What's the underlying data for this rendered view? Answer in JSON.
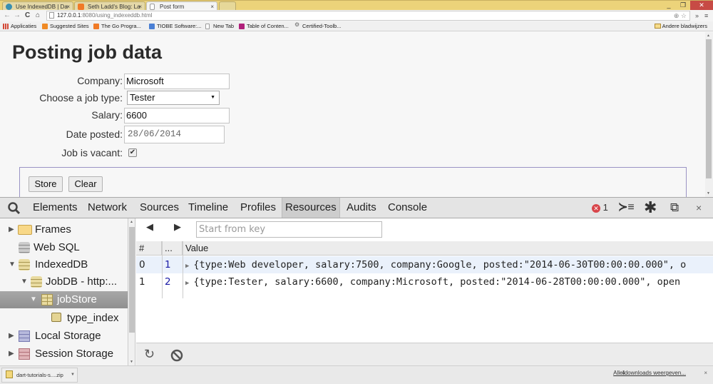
{
  "browser": {
    "tabs": [
      {
        "title": "Use IndexedDB | Da",
        "icon": "dart-icon",
        "icon_color": "#3a8fb0",
        "active": false
      },
      {
        "title": "Seth Ladd's Blog: La",
        "icon": "blogger-icon",
        "icon_color": "#f07a27",
        "active": false
      },
      {
        "title": "Post form",
        "icon": "page-icon",
        "icon_color": "#ffffff",
        "active": true
      }
    ],
    "url_host": "127.0.0.1",
    "url_rest": ":8080/using_indexeddb.html",
    "bookmarks": [
      {
        "label": "Applicaties",
        "icon": "apps-grid-icon",
        "color": "#d34836"
      },
      {
        "label": "Suggested Sites",
        "icon": "suggested-sites-icon",
        "color": "#f08a24"
      },
      {
        "label": "The Go Progra...",
        "icon": "blogger-icon",
        "color": "#f07a27"
      },
      {
        "label": "TIOBE Software:...",
        "icon": "tiobe-icon",
        "color": "#4a7fd4"
      },
      {
        "label": "New Tab",
        "icon": "page-icon",
        "color": "#ffffff"
      },
      {
        "label": "Table of Conten...",
        "icon": "toc-icon",
        "color": "#b0207a"
      },
      {
        "label": "Certified-Toolb...",
        "icon": "toolbox-icon",
        "color": "#666666"
      }
    ],
    "other_bookmarks": "Andere bladwijzers"
  },
  "page": {
    "title": "Posting job data",
    "form": {
      "company_label": "Company:",
      "company_value": "Microsoft",
      "job_type_label": "Choose a job type:",
      "job_type_value": "Tester",
      "salary_label": "Salary:",
      "salary_value": "6600",
      "date_label": "Date posted:",
      "date_value": "28/06/2014",
      "vacant_label": "Job is vacant:",
      "vacant_checked": true,
      "checkmark": "✔"
    },
    "buttons": {
      "store": "Store",
      "clear": "Clear"
    }
  },
  "devtools": {
    "tabs": [
      "Elements",
      "Network",
      "Sources",
      "Timeline",
      "Profiles",
      "Resources",
      "Audits",
      "Console"
    ],
    "active_tab": "Resources",
    "error_count": "1",
    "sidebar": [
      {
        "label": "Frames",
        "icon": "folder-icon",
        "expanded": false,
        "level": 0
      },
      {
        "label": "Web SQL",
        "icon": "database-icon",
        "expanded": null,
        "level": 0
      },
      {
        "label": "IndexedDB",
        "icon": "database-icon",
        "expanded": true,
        "level": 0
      },
      {
        "label": "JobDB - http:...",
        "icon": "database-icon",
        "expanded": true,
        "level": 1
      },
      {
        "label": "jobStore",
        "icon": "table-icon",
        "expanded": true,
        "level": 2,
        "selected": true
      },
      {
        "label": "type_index",
        "icon": "index-icon",
        "expanded": null,
        "level": 3
      },
      {
        "label": "Local Storage",
        "icon": "grid-icon",
        "expanded": false,
        "level": 0
      },
      {
        "label": "Session Storage",
        "icon": "grid-icon",
        "expanded": false,
        "level": 0
      }
    ],
    "key_placeholder": "Start from key",
    "columns": [
      "#",
      "...",
      "Value"
    ],
    "rows": [
      {
        "index": "0",
        "key": "1",
        "value": "{type:Web developer, salary:7500, company:Google, posted:\"2014-06-30T00:00:00.000\", o"
      },
      {
        "index": "1",
        "key": "2",
        "value": "{type:Tester, salary:6600, company:Microsoft, posted:\"2014-06-28T00:00:00.000\", open"
      }
    ]
  },
  "downloads": {
    "item": "dart-tutorials-s....zip",
    "show_all": "Alle downloads weergeven..."
  }
}
